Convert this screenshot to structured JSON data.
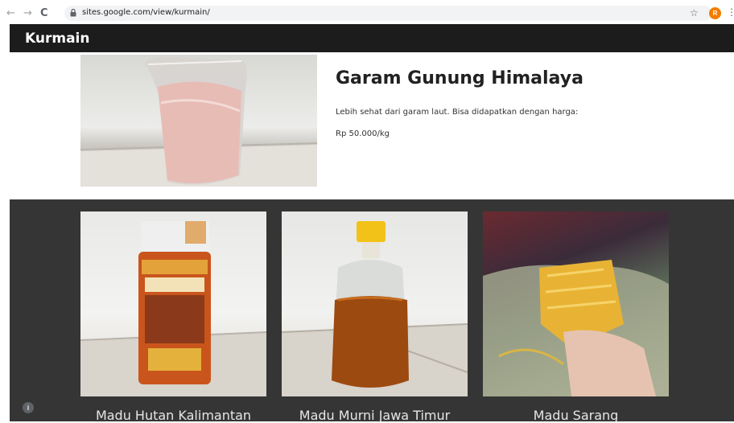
{
  "browser": {
    "back": "←",
    "forward": "→",
    "reload": "C",
    "url": "sites.google.com/view/kurmain/",
    "star": "☆",
    "avatar_letter": "R",
    "menu": "⋮"
  },
  "site": {
    "title": "Kurmain",
    "header_bg": "#1c1c1c"
  },
  "hero": {
    "title": "Garam Gunung Himalaya",
    "description": "Lebih sehat dari garam laut. Bisa didapatkan dengan harga:",
    "price": "Rp 50.000/kg"
  },
  "products": [
    {
      "name": "Madu Hutan Kalimantan"
    },
    {
      "name": "Madu Murni Jawa Timur"
    },
    {
      "name": "Madu Sarang"
    }
  ],
  "footer": {
    "info_icon": "i"
  }
}
